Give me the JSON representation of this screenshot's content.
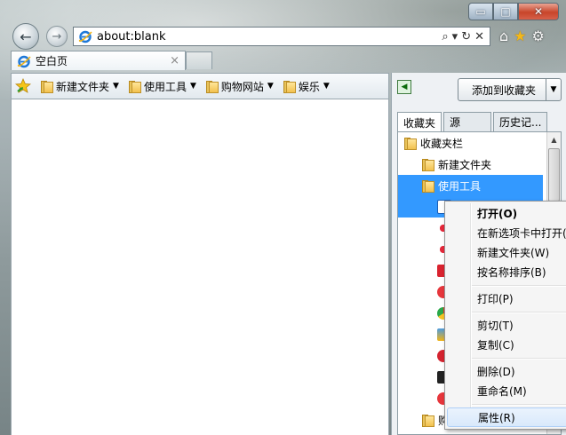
{
  "window": {
    "minimize_glyph": "▭",
    "maximize_glyph": "□",
    "close_glyph": "✕"
  },
  "nav": {
    "back_glyph": "←",
    "forward_glyph": "→",
    "address": "about:blank",
    "search_glyph": "⌕",
    "refresh_glyph": "↻",
    "stop_glyph": "✕",
    "dropdown_glyph": "▾"
  },
  "right_tools": {
    "home_glyph": "⌂",
    "favorites_glyph": "★",
    "settings_glyph": "⚙"
  },
  "tab": {
    "title": "空白页",
    "close_glyph": "×"
  },
  "favorites_bar": {
    "items": [
      {
        "label": "新建文件夹"
      },
      {
        "label": "使用工具"
      },
      {
        "label": "购物网站"
      },
      {
        "label": "娱乐"
      }
    ],
    "caret": "▼"
  },
  "panel": {
    "add_button": "添加到收藏夹",
    "dropdown_glyph": "▼",
    "tabs": [
      "收藏夹",
      "源",
      "历史记..."
    ],
    "tree": {
      "root": "收藏夹栏",
      "folder1": "新建文件夹",
      "folder2": "使用工具",
      "folder3": "购"
    },
    "colors": {
      "selection": "#3399ff",
      "folder": "#f2c14e"
    }
  },
  "context_menu": {
    "items": [
      {
        "label": "打开(O)"
      },
      {
        "label": "在新选项卡中打开("
      },
      {
        "label": "新建文件夹(W)"
      },
      {
        "label": "按名称排序(B)"
      },
      {
        "label": "打印(P)"
      },
      {
        "label": "剪切(T)"
      },
      {
        "label": "复制(C)"
      },
      {
        "label": "删除(D)"
      },
      {
        "label": "重命名(M)"
      },
      {
        "label": "属性(R)"
      }
    ]
  }
}
